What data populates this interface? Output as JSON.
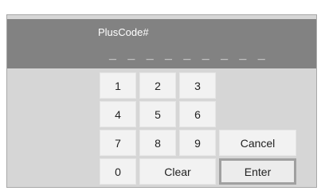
{
  "dialog": {
    "title": "PlusCode#",
    "entry_mask": "_ _ _ _ _ _ _ _ _"
  },
  "keypad": {
    "k1": "1",
    "k2": "2",
    "k3": "3",
    "k4": "4",
    "k5": "5",
    "k6": "6",
    "k7": "7",
    "k8": "8",
    "k9": "9",
    "k0": "0",
    "clear": "Clear",
    "cancel": "Cancel",
    "enter": "Enter"
  }
}
